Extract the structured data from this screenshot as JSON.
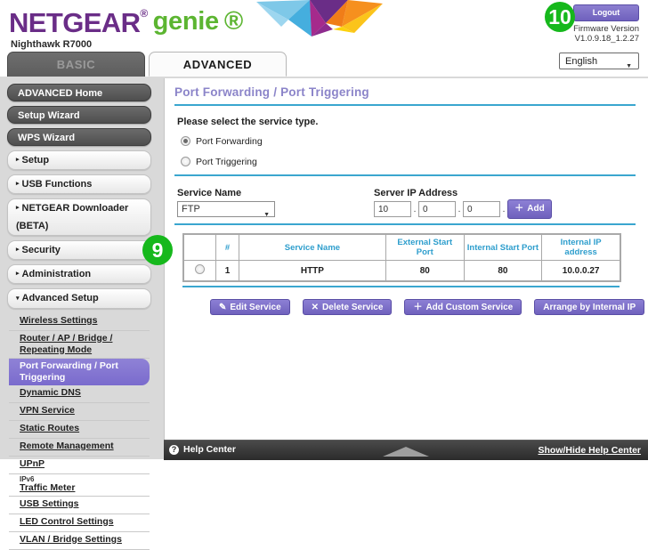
{
  "header": {
    "brand_netgear": "NETGEAR",
    "brand_genie": "genie",
    "registered_mark": "®",
    "model": "Nighthawk R7000",
    "logout_label": "Logout",
    "firmware_label": "Firmware Version",
    "firmware_version": "V1.0.9.18_1.2.27",
    "language_selected": "English",
    "caret": "▼",
    "badge_10": "10",
    "colors": {
      "purple": "#6a2d87",
      "green": "#5cb531",
      "accent_blue": "#3aa6cf",
      "button_purple": "#6f61bd",
      "badge_green": "#16b81c"
    }
  },
  "tabs": [
    {
      "label": "BASIC",
      "active": false
    },
    {
      "label": "ADVANCED",
      "active": true
    }
  ],
  "sidebar": {
    "primary": [
      {
        "label": "ADVANCED Home"
      },
      {
        "label": "Setup Wizard"
      },
      {
        "label": "WPS Wizard"
      }
    ],
    "sections": [
      {
        "label": "Setup",
        "arrow": "▸"
      },
      {
        "label": "USB Functions",
        "arrow": "▸"
      },
      {
        "label": "NETGEAR Downloader (BETA)",
        "arrow": "▸"
      },
      {
        "label": "Security",
        "arrow": "▸"
      },
      {
        "label": "Administration",
        "arrow": "▸"
      },
      {
        "label": "Advanced Setup",
        "arrow": "▾"
      }
    ],
    "advanced_items": [
      {
        "label": "Wireless Settings",
        "active": false
      },
      {
        "label": "Router / AP / Bridge / Repeating Mode",
        "active": false
      },
      {
        "label": "Port Forwarding / Port Triggering",
        "active": true
      },
      {
        "label": "Dynamic DNS",
        "active": false
      },
      {
        "label": "VPN Service",
        "active": false
      },
      {
        "label": "Static Routes",
        "active": false
      },
      {
        "label": "Remote Management",
        "active": false
      },
      {
        "label": "UPnP",
        "active": false
      },
      {
        "label": "Traffic Meter",
        "active": false,
        "above": "IPv6"
      },
      {
        "label": "USB Settings",
        "active": false
      },
      {
        "label": "LED Control Settings",
        "active": false
      },
      {
        "label": "VLAN / Bridge Settings",
        "active": false
      }
    ]
  },
  "main": {
    "page_title": "Port Forwarding / Port Triggering",
    "instruction": "Please select the service type.",
    "badge_9": "9",
    "service_type": [
      {
        "label": "Port Forwarding",
        "selected": true
      },
      {
        "label": "Port Triggering",
        "selected": false
      }
    ],
    "service_name_label": "Service Name",
    "service_name_value": "FTP",
    "server_ip_label": "Server IP Address",
    "server_ip": {
      "octet1": "10",
      "octet2": "0",
      "octet3": "0",
      "octet4": ""
    },
    "add_button": "Add",
    "add_icon": "＋",
    "table": {
      "headers": [
        "",
        "#",
        "Service Name",
        "External Start Port",
        "Internal Start Port",
        "Internal IP address"
      ],
      "rows": [
        {
          "selected": false,
          "num": "1",
          "service_name": "HTTP",
          "external_start_port": "80",
          "internal_start_port": "80",
          "internal_ip": "10.0.0.27"
        }
      ]
    },
    "actions": [
      {
        "label": "Edit Service",
        "icon": "✎"
      },
      {
        "label": "Delete Service",
        "icon": "✕"
      },
      {
        "label": "Add Custom Service",
        "icon": "＋"
      },
      {
        "label": "Arrange by Internal IP",
        "icon": ""
      }
    ]
  },
  "footer": {
    "help_center": "Help Center",
    "help_icon": "?",
    "show_hide": "Show/Hide Help Center"
  }
}
